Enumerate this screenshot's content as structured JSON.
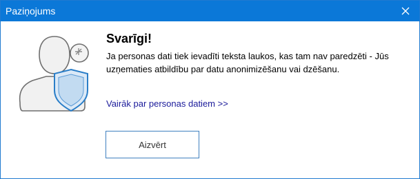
{
  "window": {
    "title": "Paziņojums"
  },
  "content": {
    "heading": "Svarīgi!",
    "message": "Ja personas dati tiek ievadīti teksta laukos, kas tam nav paredzēti - Jūs uzņematies atbildību par datu anonimizēšanu vai dzēšanu.",
    "link_label": "Vairāk par personas datiem >>",
    "button_label": "Aizvērt"
  },
  "icons": {
    "close": "close-icon",
    "illustration": "user-shield-icon"
  },
  "colors": {
    "titlebar": "#0b78d8",
    "link": "#1a1a9a",
    "button_border": "#3e7fbf",
    "shield": "#2a7ec8"
  }
}
